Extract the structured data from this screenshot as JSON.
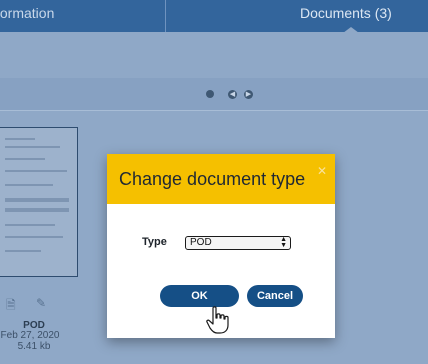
{
  "tabs": [
    {
      "label": "formation"
    },
    {
      "label": "Documents (3)"
    }
  ],
  "pager": {
    "prev_icon": "chevron-left-icon",
    "next_icon": "chevron-right-icon"
  },
  "document": {
    "name": "POD",
    "date": "Feb 27, 2020",
    "size": "5.41 kb",
    "download_icon": "download-file-icon",
    "edit_icon": "pencil-icon"
  },
  "modal": {
    "title": "Change document type",
    "close_icon": "close-icon",
    "type_label": "Type",
    "type_value": "POD",
    "ok_label": "OK",
    "cancel_label": "Cancel"
  },
  "colors": {
    "header_bg": "#33659c",
    "modal_header_bg": "#f5c000",
    "button_bg": "#154f86",
    "overlay_bg": "#8fa8c7"
  }
}
